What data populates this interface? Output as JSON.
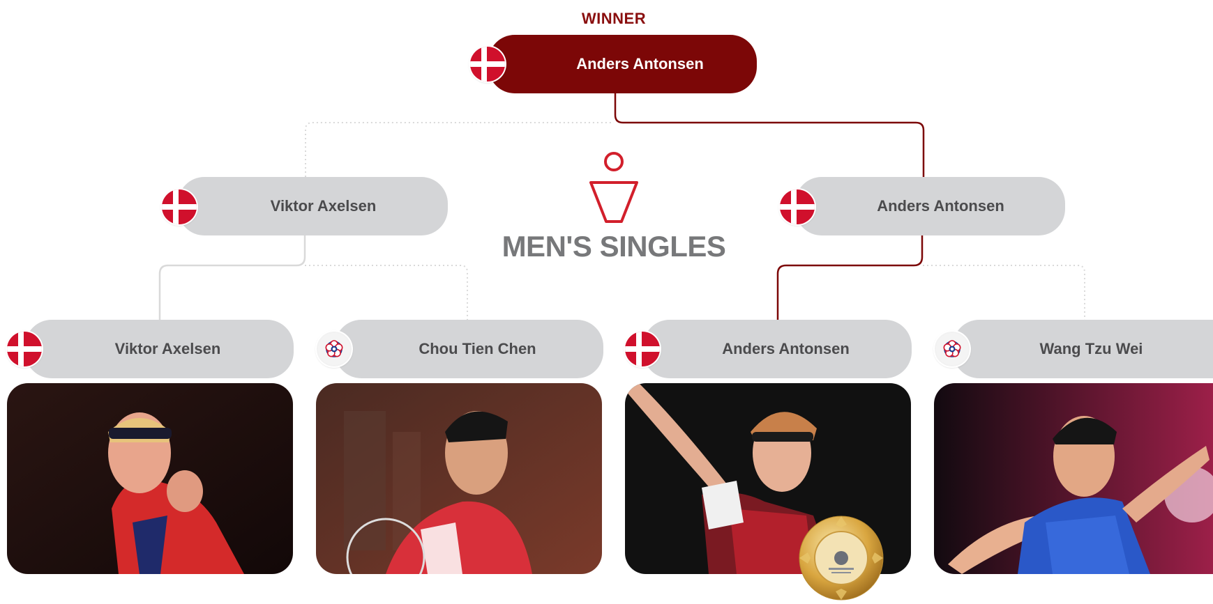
{
  "bracket": {
    "winner_label": "WINNER",
    "event_title": "MEN'S SINGLES",
    "winner": {
      "name": "Anders Antonsen",
      "flag": "denmark-flag"
    },
    "finalists": [
      {
        "name": "Viktor Axelsen",
        "flag": "denmark-flag"
      },
      {
        "name": "Anders Antonsen",
        "flag": "denmark-flag"
      }
    ],
    "semifinalists": [
      {
        "name": "Viktor Axelsen",
        "flag": "denmark-flag"
      },
      {
        "name": "Chou Tien Chen",
        "flag": "chinese-taipei-flag"
      },
      {
        "name": "Anders Antonsen",
        "flag": "denmark-flag"
      },
      {
        "name": "Wang Tzu Wei",
        "flag": "chinese-taipei-flag"
      }
    ]
  },
  "colors": {
    "winner_red": "#7c0707",
    "pill_grey": "#d4d5d7",
    "path_red": "#7c0707",
    "path_grey": "#d9d9d9",
    "title_grey": "#77787a"
  },
  "icons": [
    "shuttlecock-player-icon",
    "gold-medal-icon"
  ]
}
